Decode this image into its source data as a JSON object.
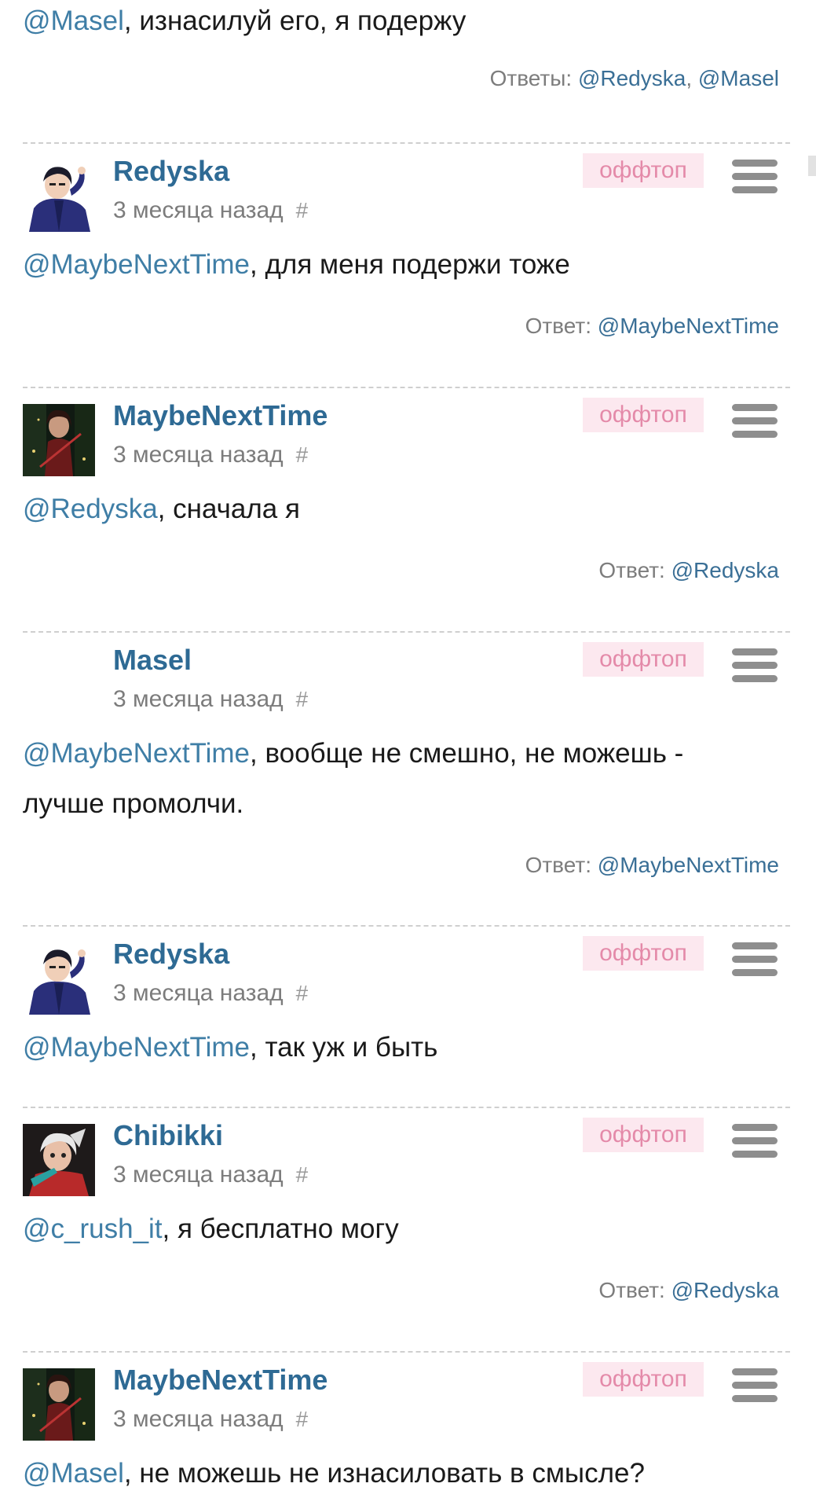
{
  "top": {
    "mention": "@Masel",
    "text": ", изнасилуй его, я подержу",
    "replies_label": "Ответы:",
    "replies": [
      "@Redyska",
      "@Masel"
    ]
  },
  "offtop_label": "оффтоп",
  "hash_symbol": "#",
  "comments": [
    {
      "username": "Redyska",
      "date": "3 месяца назад",
      "avatar_icon": "redyska-avatar",
      "body_lines": [
        {
          "mention": "@MaybeNextTime",
          "text": ", для меня подержи тоже"
        }
      ],
      "replies_label": "Ответ:",
      "replies": [
        "@MaybeNextTime"
      ]
    },
    {
      "username": "MaybeNextTime",
      "date": "3 месяца назад",
      "avatar_icon": "maybenexttime-avatar",
      "body_lines": [
        {
          "mention": "@Redyska",
          "text": ", сначала я"
        }
      ],
      "replies_label": "Ответ:",
      "replies": [
        "@Redyska"
      ]
    },
    {
      "username": "Masel",
      "date": "3 месяца назад",
      "avatar_icon": "",
      "body_lines": [
        {
          "mention": "@MaybeNextTime",
          "text": ", вообще не смешно, не можешь -"
        },
        {
          "mention": "",
          "text": "лучше промолчи."
        }
      ],
      "replies_label": "Ответ:",
      "replies": [
        "@MaybeNextTime"
      ]
    },
    {
      "username": "Redyska",
      "date": "3 месяца назад",
      "avatar_icon": "redyska-avatar",
      "body_lines": [
        {
          "mention": "@MaybeNextTime",
          "text": ", так уж и быть"
        }
      ],
      "replies_label": "",
      "replies": []
    },
    {
      "username": "Chibikki",
      "date": "3 месяца назад",
      "avatar_icon": "chibikki-avatar",
      "body_lines": [
        {
          "mention": "@c_rush_it",
          "text": ", я бесплатно могу"
        }
      ],
      "replies_label": "Ответ:",
      "replies": [
        "@Redyska"
      ]
    },
    {
      "username": "MaybeNextTime",
      "date": "3 месяца назад",
      "avatar_icon": "maybenexttime-avatar",
      "body_lines": [
        {
          "mention": "@Masel",
          "text": ", не можешь не изнасиловать в смысле?"
        }
      ],
      "replies_label": "",
      "replies": []
    }
  ]
}
